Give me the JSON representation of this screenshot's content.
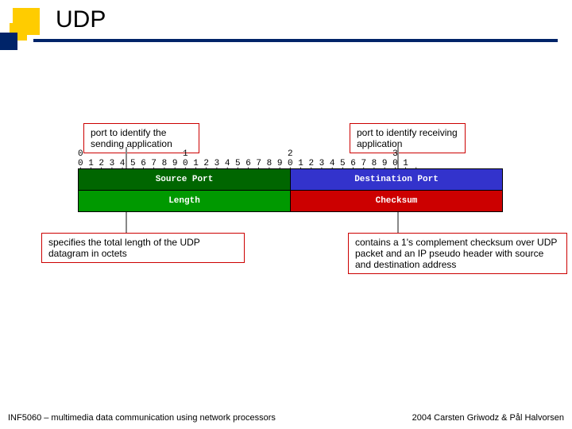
{
  "title": "UDP",
  "callouts": {
    "send_port": "port to identify the sending application",
    "recv_port": "port to identify receiving application",
    "length": "specifies the total length of the UDP datagram in octets",
    "checksum": "contains a 1's complement checksum over UDP packet and an IP pseudo header with source and destination address"
  },
  "ruler": {
    "line1": "0                   1                   2                   3",
    "line2": "0 1 2 3 4 5 6 7 8 9 0 1 2 3 4 5 6 7 8 9 0 1 2 3 4 5 6 7 8 9 0 1",
    "sep": "+-+-+-+-+-+-+-+-+-+-+-+-+-+-+-+-+-+-+-+-+-+-+-+-+-+-+-+-+-+-+-+-+"
  },
  "fields": {
    "source_port": "Source Port",
    "dest_port": "Destination Port",
    "length": "Length",
    "checksum": "Checksum"
  },
  "footer": {
    "left": "INF5060 – multimedia data communication using network processors",
    "right": "2004  Carsten Griwodz & Pål Halvorsen"
  }
}
